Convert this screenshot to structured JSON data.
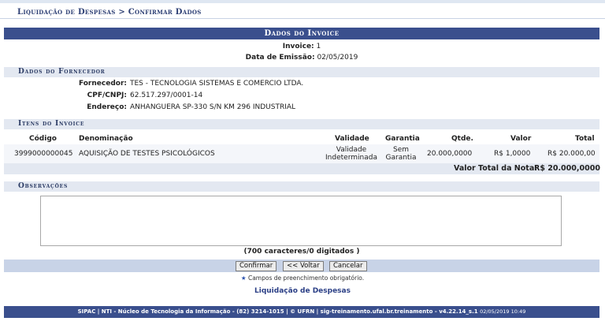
{
  "breadcrumb": "Liquidação de Despesas > Confirmar Dados",
  "form": {
    "title": "Dados do Invoice",
    "invoice_label": "Invoice:",
    "invoice_value": "1",
    "emissao_label": "Data de Emissão:",
    "emissao_value": "02/05/2019"
  },
  "fornecedor": {
    "section_title": "Dados do Fornecedor",
    "fields": [
      {
        "label": "Fornecedor:",
        "value": "TES - TECNOLOGIA SISTEMAS E COMERCIO LTDA."
      },
      {
        "label": "CPF/CNPJ:",
        "value": "62.517.297/0001-14"
      },
      {
        "label": "Endereço:",
        "value": "ANHANGUERA SP-330 S/N KM 296 INDUSTRIAL"
      }
    ]
  },
  "itens": {
    "section_title": "Itens do Invoice",
    "columns": [
      "Código",
      "Denominação",
      "Validade",
      "Garantia",
      "Qtde.",
      "Valor",
      "Total"
    ],
    "rows": [
      {
        "codigo": "3999000000045",
        "denominacao": "AQUISIÇÃO DE TESTES PSICOLÓGICOS",
        "validade_1": "Validade",
        "validade_2": "Indeterminada",
        "garantia_1": "Sem",
        "garantia_2": "Garantia",
        "qtde": "20.000,0000",
        "valor": "R$ 1,0000",
        "total": "R$ 20.000,00"
      }
    ],
    "total_label": "Valor Total da Nota:",
    "total_value": "R$ 20.000,0000"
  },
  "observacoes": {
    "section_title": "Observações",
    "value": "",
    "counter": "(700 caracteres/0 digitados )"
  },
  "buttons": {
    "confirmar": "Confirmar",
    "voltar": "<< Voltar",
    "cancelar": "Cancelar"
  },
  "required_note": "Campos de preenchimento obrigatório.",
  "required_star": "★",
  "home_link": "Liquidação de Despesas",
  "footer": {
    "text": "SIPAC | NTI - Núcleo de Tecnologia da Informação - (82) 3214-1015 | © UFRN | sig-treinamento.ufal.br.treinamento - v4.22.14_s.1",
    "timestamp": "02/05/2019 10:49"
  },
  "colors": {
    "header_blue": "#3a4f8d",
    "subheader_bg": "#e3e8f1",
    "button_bar_bg": "#c8d3e7"
  }
}
